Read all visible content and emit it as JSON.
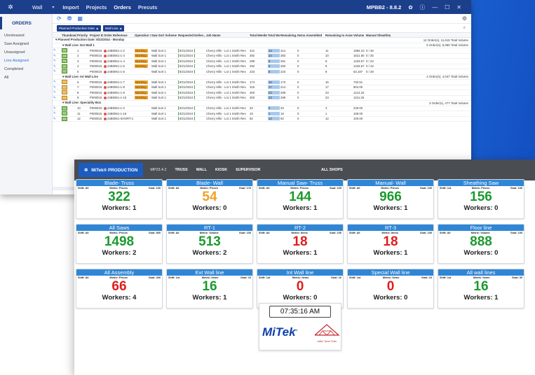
{
  "app_window": {
    "app_name": "Wall",
    "menu": [
      "Import",
      "Projects",
      "Orders",
      "Precuts"
    ],
    "active_menu": "Orders",
    "version": "MPBB2 - 8.8.2",
    "window_buttons": {
      "minimize": "—",
      "maximize": "☐",
      "close": "✕"
    }
  },
  "sidebar": {
    "header": "ORDERS",
    "items": [
      "Unreleased",
      "Saw Assigned",
      "Unassigned",
      "Line Assigned",
      "Completed",
      "All"
    ],
    "active_item": "Line Assigned"
  },
  "grouping": {
    "chips": [
      "Planned Production Date ▲",
      "Wall Line ▲"
    ]
  },
  "grid": {
    "columns": [
      "",
      "Thumbnail",
      "Priority ▼",
      "Project ID",
      "Order Reference",
      "Operation Status",
      "Saw Sort Scheme",
      "Requested Delive...",
      "Job Name",
      "Total Members",
      "Total Walls",
      "Remaining...",
      "Items Assembled",
      "Remaining to Assemble",
      "Volume",
      "Manual Sheathing..."
    ],
    "top_group": {
      "label": "Planned Production Date: 8/22/2024 - Monday",
      "summary": "12 Order(s),  11,615 Total Volume"
    },
    "groups": [
      {
        "label": "Wall Line: Ext Wall 1",
        "summary": "5 Order(s),  6,080 Total Volume",
        "rows": [
          {
            "n": "1",
            "pid": "P000015",
            "ref": "24B0061-1-2",
            "op": "Working",
            "saw": "Wall Sort 1",
            "req": "8/21/2024",
            "job": "Cherry Hills - Lot 1 Smith Res",
            "tm": "441",
            "tw": "14",
            "rem": "414",
            "ia": "0",
            "ra": "11",
            "vol": "1984.10",
            "ms": "0 / 48"
          },
          {
            "n": "2",
            "pid": "P000015",
            "ref": "24B0061-1-3",
            "op": "Working",
            "saw": "Wall Sort 1",
            "req": "8/21/2024",
            "job": "Cherry Hills - Lot 1 Smith Res",
            "tm": "392",
            "tw": "14",
            "rem": "383",
            "ia": "0",
            "ra": "10",
            "vol": "1621.80",
            "ms": "0 / 25"
          },
          {
            "n": "3",
            "pid": "P000015",
            "ref": "24B0061-1-4",
            "op": "Working",
            "saw": "Wall Sort 1",
            "req": "8/21/2024",
            "job": "Cherry Hills - Lot 1 Smith Res",
            "tm": "289",
            "tw": "8",
            "rem": "281",
            "ia": "0",
            "ra": "8",
            "vol": "1233.67",
            "ms": "0 / 23"
          },
          {
            "n": "4",
            "pid": "P000015",
            "ref": "24B0061-1-6",
            "op": "Working",
            "saw": "Wall Sort 1",
            "req": "8/21/2024",
            "job": "Cherry Hills - Lot 1 Smith Res",
            "tm": "292",
            "tw": "8",
            "rem": "283",
            "ia": "0",
            "ra": "8",
            "vol": "1233.67",
            "ms": "0 / 23"
          },
          {
            "n": "5",
            "pid": "P000015",
            "ref": "24B0061-1-5",
            "op": "",
            "saw": "Wall Sort 1",
            "req": "8/21/2024",
            "job": "Cherry Hills - Lot 1 Smith Res",
            "tm": "233",
            "tw": "8",
            "rem": "233",
            "ia": "0",
            "ra": "8",
            "vol": "63.187",
            "ms": "0 / 28"
          }
        ]
      },
      {
        "label": "Wall Line: Int Wall Line",
        "summary": "4 Order(s),  4,047 Total Volume",
        "rows": [
          {
            "n": "6",
            "pid": "P000015",
            "ref": "24B0061-1-7",
            "op": "Working",
            "saw": "Wall Sort 1",
            "req": "8/21/2024",
            "job": "Cherry Hills - Lot 1 Smith Res",
            "tm": "174",
            "tw": "16",
            "rem": "173",
            "ia": "0",
            "ra": "16",
            "vol": "732.51",
            "ms": ""
          },
          {
            "n": "7",
            "pid": "P000015",
            "ref": "24B0061-1-8",
            "op": "Working",
            "saw": "Wall Sort 1",
            "req": "8/21/2024",
            "job": "Cherry Hills - Lot 1 Smith Res",
            "tm": "315",
            "tw": "17",
            "rem": "214",
            "ia": "0",
            "ra": "17",
            "vol": "904.00",
            "ms": ""
          },
          {
            "n": "8",
            "pid": "P000015",
            "ref": "24B0061-1-9",
            "op": "Working",
            "saw": "Wall Sort 1",
            "req": "8/21/2024",
            "job": "Cherry Hills - Lot 1 Smith Res",
            "tm": "300",
            "tw": "23",
            "rem": "299",
            "ia": "0",
            "ra": "23",
            "vol": "1214.22",
            "ms": ""
          },
          {
            "n": "9",
            "pid": "P000015",
            "ref": "24B0061-1-10",
            "op": "Working",
            "saw": "Wall Sort 1",
            "req": "8/21/2024",
            "job": "Cherry Hills - Lot 1 Smith Res",
            "tm": "300",
            "tw": "23",
            "rem": "299",
            "ia": "0",
            "ra": "23",
            "vol": "1211.25",
            "ms": ""
          }
        ]
      },
      {
        "label": "Wall Line: Speciality Box",
        "summary": "3 Order(s),  477 Total Volume",
        "rows": [
          {
            "n": "10",
            "pid": "P000015",
            "ref": "24B0061-1-2",
            "op": "",
            "saw": "Wall Sort 1",
            "req": "8/21/2024",
            "job": "Cherry Hills - Lot 1 Smith Res",
            "tm": "33",
            "tw": "3",
            "rem": "33",
            "ia": "0",
            "ra": "3",
            "vol": "229.00",
            "ms": ""
          },
          {
            "n": "11",
            "pid": "P000015",
            "ref": "24B0061-1-15",
            "op": "",
            "saw": "Wall Sort 1",
            "req": "8/21/2024",
            "job": "Cherry Hills - Lot 1 Smith Res",
            "tm": "19",
            "tw": "1",
            "rem": "19",
            "ia": "0",
            "ra": "1",
            "vol": "108.00",
            "ms": ""
          },
          {
            "n": "12",
            "pid": "P000015",
            "ref": "24B0061-SHORT-1",
            "op": "",
            "saw": "Wall Sort 1",
            "req": "8/21/2024",
            "job": "Cherry Hills - Lot 1 Smith Res",
            "tm": "92",
            "tw": "12",
            "rem": "92",
            "ia": "0",
            "ra": "12",
            "vol": "100.00",
            "ms": ""
          }
        ]
      }
    ]
  },
  "dashboard": {
    "brand": "MiTek® PRODUCTION",
    "nav": [
      "MP23.4.2",
      "TRUSS",
      "WALL",
      "KIOSK",
      "SUPERVISOR"
    ],
    "shops": "ALL SHOPS",
    "cards": [
      {
        "title": "Blade- Truss",
        "shift": "Shift: All",
        "metric": "Metric: Pieces",
        "goal": "Goal: 100",
        "value": "322",
        "color": "green",
        "workers": "Workers: 1"
      },
      {
        "title": "Blade- Wall",
        "shift": "Shift: All",
        "metric": "Metric: Pieces",
        "goal": "Goal: 176",
        "value": "54",
        "color": "orange",
        "workers": "Workers: 0"
      },
      {
        "title": "Manual Saw- Truss",
        "shift": "Shift: All",
        "metric": "Metric: Pieces",
        "goal": "Goal: 100",
        "value": "144",
        "color": "green",
        "workers": "Workers: 1"
      },
      {
        "title": "Manual- Wall",
        "shift": "Shift: All",
        "metric": "Metric: Pieces",
        "goal": "Goal: 100",
        "value": "966",
        "color": "green",
        "workers": "Workers: 1"
      },
      {
        "title": "Sheathing Saw",
        "shift": "Shift: 1st",
        "metric": "Metric: Pieces",
        "goal": "Goal: 100",
        "value": "156",
        "color": "green",
        "workers": "Workers: 0"
      },
      {
        "title": "All Saws",
        "shift": "Shift: All",
        "metric": "Metric: Pieces",
        "goal": "Goal: 800",
        "value": "1498",
        "color": "green",
        "workers": "Workers: 2"
      },
      {
        "title": "RT-1",
        "shift": "Shift: All",
        "metric": "Metric: Volume",
        "goal": "Goal: 100",
        "value": "513",
        "color": "green",
        "workers": "Workers: 2"
      },
      {
        "title": "RT-2",
        "shift": "Shift: All",
        "metric": "Metric: Items",
        "goal": "Goal: 100",
        "value": "18",
        "color": "red",
        "workers": "Workers: 1"
      },
      {
        "title": "RT-3",
        "shift": "Shift: All",
        "metric": "Metric: Items",
        "goal": "Goal: 100",
        "value": "18",
        "color": "red",
        "workers": "Workers: 1"
      },
      {
        "title": "Floor line",
        "shift": "Shift: All",
        "metric": "Metric: Volume",
        "goal": "Goal: 100",
        "value": "888",
        "color": "green",
        "workers": "Workers: 0"
      },
      {
        "title": "All Assembly",
        "shift": "Shift: All",
        "metric": "Metric: Pieces",
        "goal": "Goal: 400",
        "value": "66",
        "color": "red",
        "workers": "Workers: 4"
      },
      {
        "title": "Ext Wall line",
        "shift": "Shift: 1st",
        "metric": "Metric: Items",
        "goal": "Goal: 10",
        "value": "16",
        "color": "green",
        "workers": "Workers: 1"
      },
      {
        "title": "Int Wall line",
        "shift": "Shift: 1st",
        "metric": "Metric: Items",
        "goal": "Goal: 10",
        "value": "0",
        "color": "red",
        "workers": "Workers: 0"
      },
      {
        "title": "Special Wall line",
        "shift": "Shift: 1st",
        "metric": "Metric: Items",
        "goal": "Goal: 10",
        "value": "0",
        "color": "red",
        "workers": "Workers: 0"
      },
      {
        "title": "All wall lines",
        "shift": "Shift: 1st",
        "metric": "Metric: Items",
        "goal": "Goal: 30",
        "value": "16",
        "color": "green",
        "workers": "Workers: 1"
      }
    ],
    "clock": "07:35:16 AM",
    "logo_text": "MiTek",
    "logo_sup": "®",
    "partner_logo_text": "Justin Tyme Truss"
  }
}
